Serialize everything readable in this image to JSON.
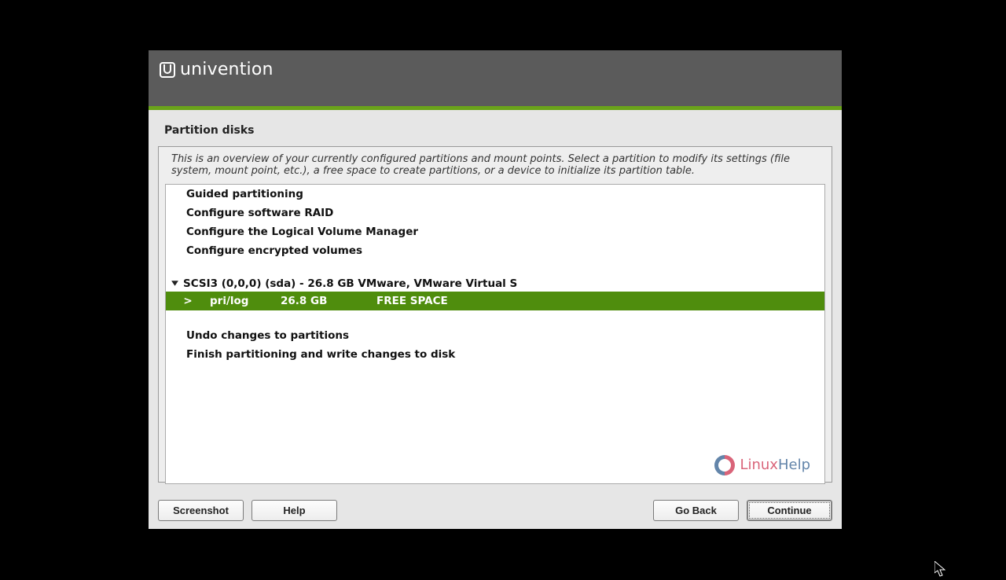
{
  "brand": {
    "name": "univention"
  },
  "page": {
    "title": "Partition disks"
  },
  "intro": "This is an overview of your currently configured partitions and mount points. Select a partition to modify its settings (file system, mount point, etc.), a free space to create partitions, or a device to initialize its partition table.",
  "menu": {
    "guided": "Guided partitioning",
    "raid": "Configure software RAID",
    "lvm": "Configure the Logical Volume Manager",
    "encrypted": "Configure encrypted volumes",
    "undo": "Undo changes to partitions",
    "finish": "Finish partitioning and write changes to disk"
  },
  "device": {
    "label": "SCSI3 (0,0,0) (sda) - 26.8 GB VMware, VMware Virtual S"
  },
  "selected": {
    "caret": ">",
    "type": "pri/log",
    "size": "26.8 GB",
    "label": "FREE SPACE"
  },
  "watermark": {
    "a": "Linux",
    "b": "Help"
  },
  "buttons": {
    "screenshot": "Screenshot",
    "help": "Help",
    "goback": "Go Back",
    "continue": "Continue"
  }
}
